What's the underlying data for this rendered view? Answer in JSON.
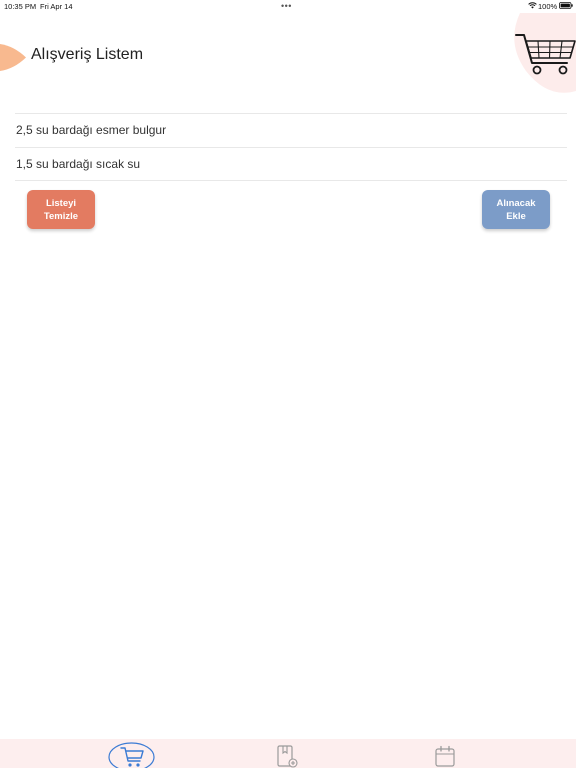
{
  "status_bar": {
    "time": "10:35 PM",
    "date": "Fri Apr 14",
    "dots": "•••",
    "battery_percent": "100%"
  },
  "header": {
    "title": "Alışveriş Listem",
    "illustration": "shopping-cart-icon"
  },
  "shopping_list": {
    "items": [
      {
        "text": "2,5 su bardağı esmer bulgur"
      },
      {
        "text": "1,5 su bardağı sıcak su"
      }
    ]
  },
  "actions": {
    "clear": {
      "line1": "Listeyi",
      "line2": "Temizle",
      "color": "#e37b61"
    },
    "add": {
      "line1": "Alınacak",
      "line2": "Ekle",
      "color": "#7c9cc8"
    }
  },
  "tab_bar": {
    "background": "#fdeeee",
    "active_color": "#3b7bd4",
    "tabs": [
      {
        "icon": "shopping-cart-icon",
        "active": true
      },
      {
        "icon": "recipe-book-icon",
        "active": false
      },
      {
        "icon": "calendar-icon",
        "active": false
      }
    ]
  },
  "colors": {
    "accent_peach": "#f8b98f",
    "blob_pink": "#fdeceb"
  }
}
